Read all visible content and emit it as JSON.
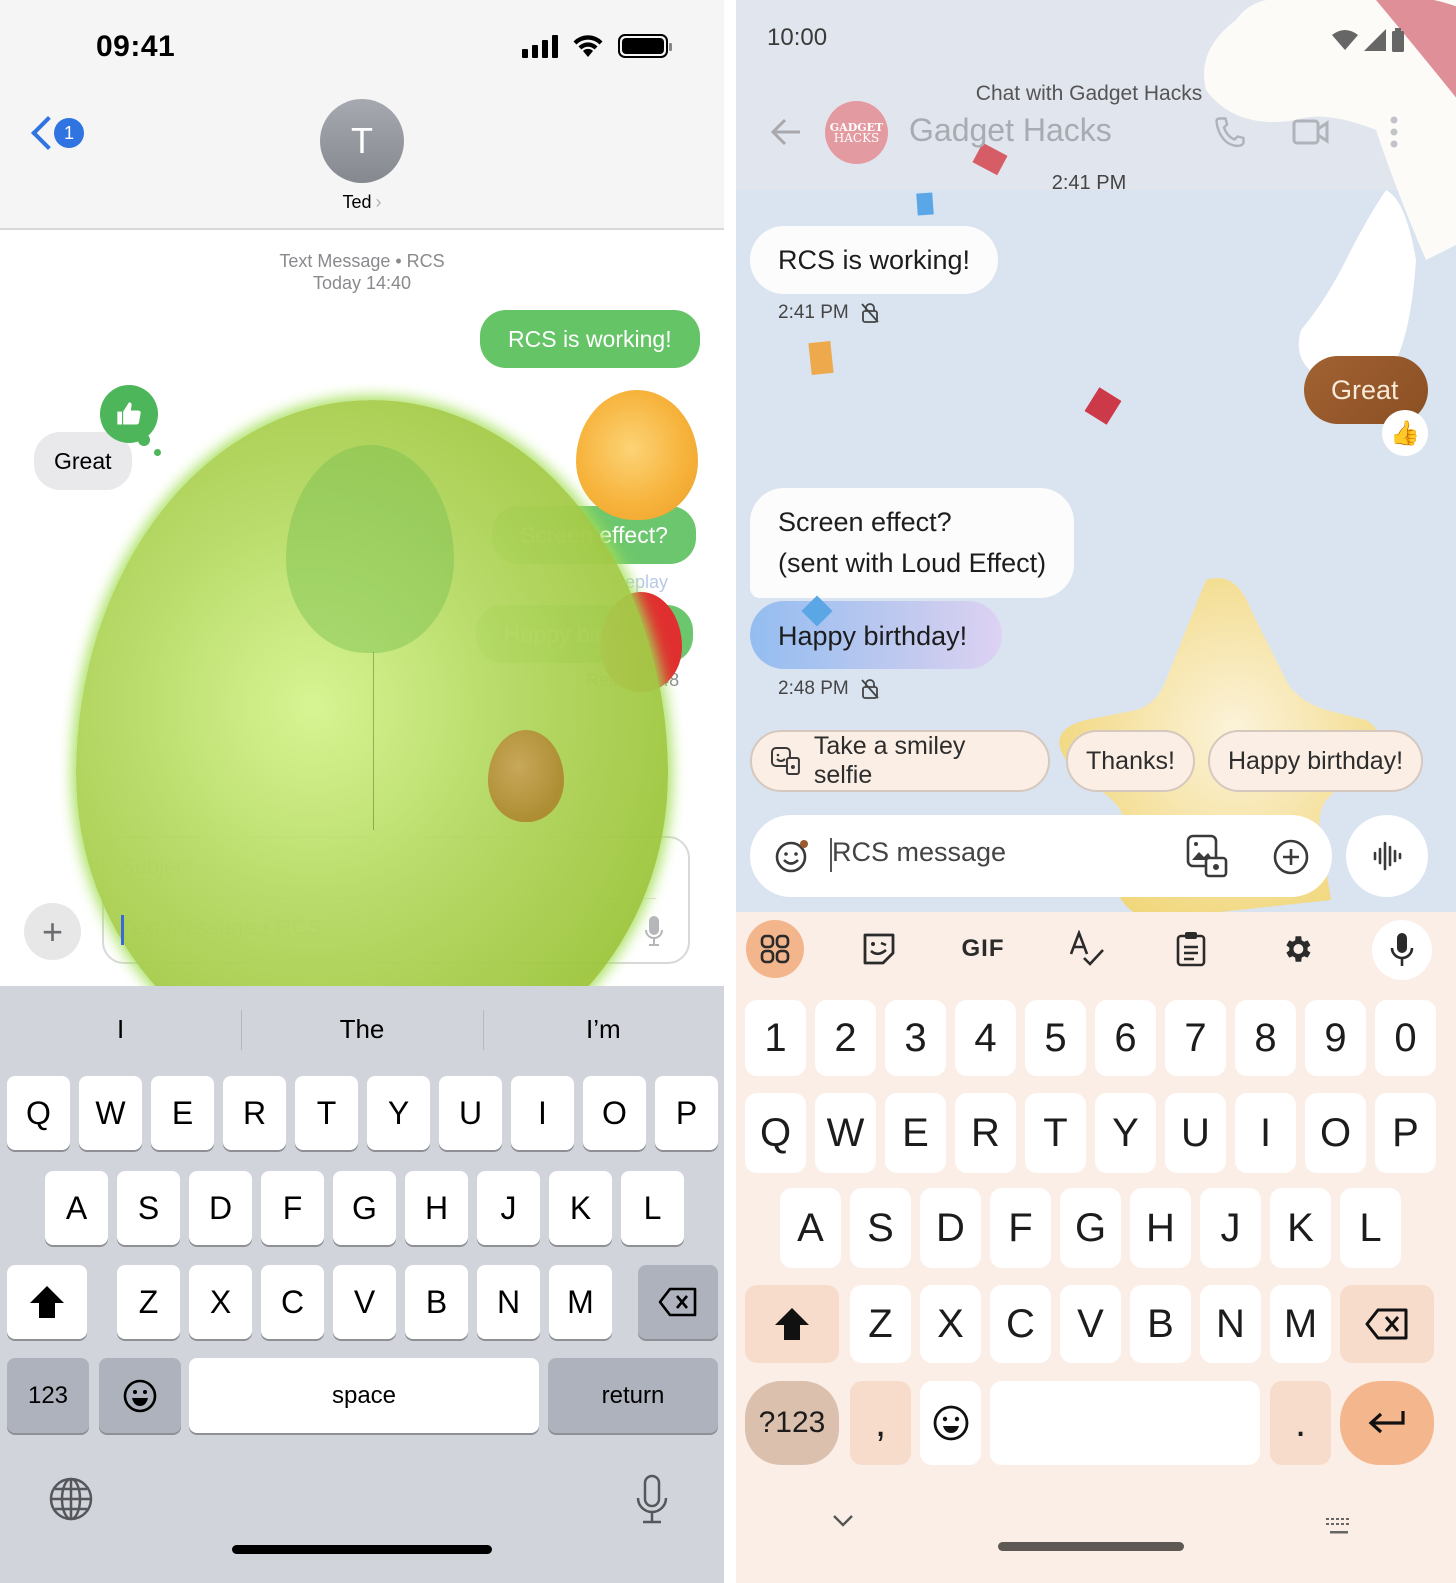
{
  "ios": {
    "status": {
      "time": "09:41"
    },
    "header": {
      "back_badge": "1",
      "avatar_initial": "T",
      "contact_name": "Ted",
      "chevron": "›"
    },
    "thread": {
      "meta_line1": "Text Message • RCS",
      "meta_line2": "Today 14:40",
      "messages": [
        {
          "direction": "out",
          "text": "RCS is working!"
        },
        {
          "direction": "in",
          "text": "Great",
          "reaction": "thumbs-up"
        },
        {
          "direction": "out",
          "text": "Screen effect?",
          "note": "Replay"
        },
        {
          "direction": "out",
          "text": "Happy birthday!",
          "note": "Read 14:48"
        }
      ],
      "visible_fragments": {
        "screen_effect": "Screen effect?",
        "replay": "Replay",
        "happy_birthday": "Happy birthday!",
        "read": "Re",
        "read_time": "48"
      }
    },
    "compose": {
      "subject_placeholder": "Subject",
      "text_placeholder": "Text Message • RCS",
      "plus": "+"
    },
    "keyboard": {
      "suggestions": [
        "I",
        "The",
        "I’m"
      ],
      "row1": [
        "Q",
        "W",
        "E",
        "R",
        "T",
        "Y",
        "U",
        "I",
        "O",
        "P"
      ],
      "row2": [
        "A",
        "S",
        "D",
        "F",
        "G",
        "H",
        "J",
        "K",
        "L"
      ],
      "row3": [
        "Z",
        "X",
        "C",
        "V",
        "B",
        "N",
        "M"
      ],
      "numbers_key": "123",
      "space_key": "space",
      "return_key": "return"
    },
    "effect": "balloons"
  },
  "android": {
    "status": {
      "time": "10:00"
    },
    "header": {
      "chat_with": "Chat with Gadget Hacks",
      "title": "Gadget Hacks",
      "logo_line1": "GADGET",
      "logo_line2": "HACKS",
      "timestamp": "2:41 PM"
    },
    "thread": {
      "messages": [
        {
          "direction": "in",
          "text": "RCS is working!",
          "time": "2:41 PM"
        },
        {
          "direction": "out",
          "text": "Great",
          "reaction": "👍"
        },
        {
          "direction": "in",
          "text_line1": "Screen effect?",
          "text_line2": "(sent with Loud Effect)"
        },
        {
          "direction": "in",
          "text": "Happy birthday!",
          "time": "2:48 PM"
        }
      ]
    },
    "smart_replies": [
      "Take a smiley selfie",
      "Thanks!",
      "Happy birthday!"
    ],
    "compose": {
      "placeholder": "RCS message"
    },
    "keyboard": {
      "toolbar": [
        "apps",
        "sticker",
        "GIF",
        "spell-check",
        "clipboard",
        "settings",
        "voice"
      ],
      "gif_label": "GIF",
      "row0": [
        "1",
        "2",
        "3",
        "4",
        "5",
        "6",
        "7",
        "8",
        "9",
        "0"
      ],
      "row1": [
        "Q",
        "W",
        "E",
        "R",
        "T",
        "Y",
        "U",
        "I",
        "O",
        "P"
      ],
      "row2": [
        "A",
        "S",
        "D",
        "F",
        "G",
        "H",
        "J",
        "K",
        "L"
      ],
      "row3": [
        "Z",
        "X",
        "C",
        "V",
        "B",
        "N",
        "M"
      ],
      "symbols_key": "?123",
      "comma_key": ",",
      "period_key": "."
    },
    "colors": {
      "accent": "#f4b78d",
      "keyboard_bg": "#fbeee6",
      "great_bubble": "#96582a"
    }
  }
}
